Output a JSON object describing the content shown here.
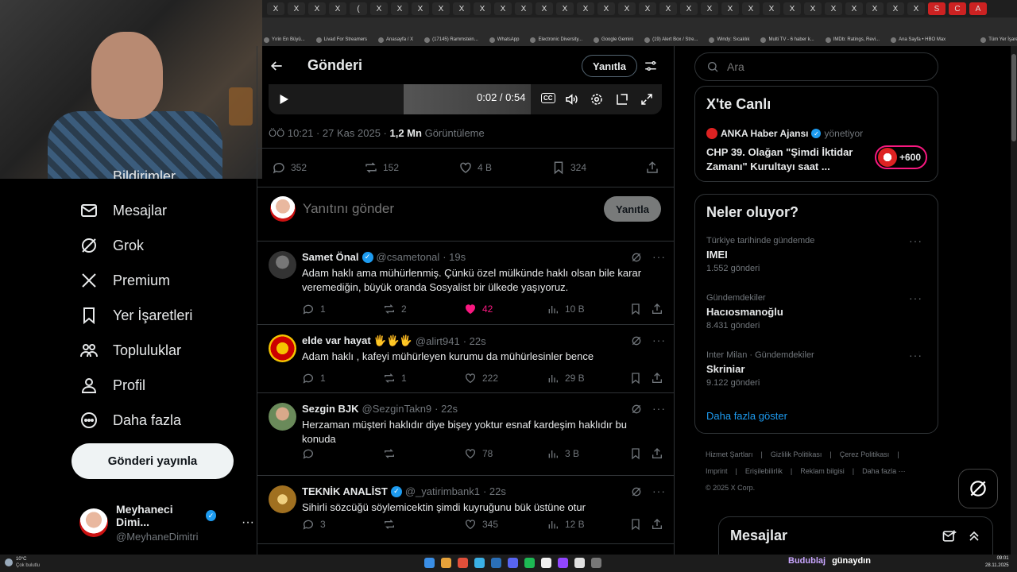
{
  "browser": {
    "tabs": [
      "X",
      "X",
      "X",
      "X",
      "(",
      "X",
      "X",
      "X",
      "X",
      "X",
      "X",
      "X",
      "X",
      "X",
      "X",
      "X",
      "X",
      "X",
      "X",
      "X",
      "X",
      "X",
      "X",
      "X",
      "X",
      "X",
      "X",
      "X",
      "X",
      "X",
      "X",
      "X",
      "S",
      "C",
      "A"
    ],
    "bookmarks": [
      "Yırin En Büyü...",
      "Livad For Streamers",
      "Anasayfa / X",
      "(17145) Rammstein...",
      "WhatsApp",
      "Electronic Diversity...",
      "Google Gemini",
      "(19) Alert Box / Stre...",
      "Windy: Sıcaklık",
      "Multi TV - 6 haber k...",
      "IMDb: Ratings, Revi...",
      "Ana Sayfa • HBO Max",
      "Tüm Yer İşaretleri"
    ]
  },
  "nav": {
    "partial_label": "Bildirimler",
    "items": [
      {
        "label": "Mesajlar",
        "icon": "mail-icon"
      },
      {
        "label": "Grok",
        "icon": "grok-icon"
      },
      {
        "label": "Premium",
        "icon": "x-logo-icon"
      },
      {
        "label": "Yer İşaretleri",
        "icon": "bookmark-icon"
      },
      {
        "label": "Topluluklar",
        "icon": "communities-icon"
      },
      {
        "label": "Profil",
        "icon": "profile-icon"
      },
      {
        "label": "Daha fazla",
        "icon": "more-circle-icon"
      }
    ],
    "post_button": "Gönderi yayınla",
    "profile": {
      "name": "Meyhaneci Dimi...",
      "handle": "@MeyhaneDimitri",
      "more": "···"
    }
  },
  "post": {
    "header_title": "Gönderi",
    "reply_button": "Yanıtla",
    "video": {
      "time": "0:02 / 0:54",
      "cc": "CC"
    },
    "timestamp": "ÖÖ 10:21 · 27 Kas 2025 · ",
    "views_count": "1,2 Mn",
    "views_label": "Görüntüleme",
    "stats": {
      "replies": "352",
      "reposts": "152",
      "likes": "4 B",
      "bookmarks": "324"
    },
    "compose": {
      "placeholder": "Yanıtını gönder",
      "button": "Yanıtla"
    }
  },
  "replies": [
    {
      "name": "Samet Önal",
      "verified": true,
      "handle": "@csametonal",
      "time": "· 19s",
      "text": "Adam haklı ama mühürlenmiş. Çünkü özel mülkünde haklı olsan bile karar veremediğin, büyük oranda Sosyalist bir ülkede yaşıyoruz.",
      "replies": "1",
      "reposts": "2",
      "likes": "42",
      "views": "10 B",
      "liked": true
    },
    {
      "name": "elde var hayat 🖐🖐🖐",
      "verified": false,
      "handle": "@alirt941",
      "time": "· 22s",
      "text": "Adam haklı , kafeyi mühürleyen kurumu da mühürlesinler bence",
      "replies": "1",
      "reposts": "1",
      "likes": "222",
      "views": "29 B",
      "liked": false
    },
    {
      "name": "Sezgin BJK",
      "verified": false,
      "handle": "@SezginTakn9",
      "time": "· 22s",
      "text": "Herzaman müşteri haklıdır diye bişey yoktur esnaf kardeşim haklıdır bu konuda",
      "replies": "",
      "reposts": "",
      "likes": "78",
      "views": "3 B",
      "liked": false
    },
    {
      "name": "TEKNİK ANALİST",
      "verified": true,
      "handle": "@_yatirimbank1",
      "time": "· 22s",
      "text": "Sihirli sözcüğü söylemicektin şimdi kuyruğunu bük üstüne otur",
      "replies": "3",
      "reposts": "",
      "likes": "345",
      "views": "12 B",
      "liked": false
    }
  ],
  "sidebar": {
    "search_placeholder": "Ara",
    "live": {
      "title": "X'te Canlı",
      "source": "ANKA Haber Ajansı",
      "action": "yönetiyor",
      "text": "CHP 39. Olağan \"Şimdi İktidar Zamanı\" Kurultayı saat ...",
      "badge": "+600"
    },
    "trends_title": "Neler oluyor?",
    "trends": [
      {
        "category": "Türkiye tarihinde gündemde",
        "name": "IMEI",
        "count": "1.552 gönderi"
      },
      {
        "category": "Gündemdekiler",
        "name": "Hacıosmanoğlu",
        "count": "8.431 gönderi"
      },
      {
        "category": "Inter Milan · Gündemdekiler",
        "name": "Skriniar",
        "count": "9.122 gönderi"
      }
    ],
    "show_more": "Daha fazla göster",
    "footer": [
      "Hizmet Şartları",
      "|",
      "Gizlilik Politikası",
      "|",
      "Çerez Politikası",
      "|",
      "Imprint",
      "|",
      "Erişilebilirlik",
      "|",
      "Reklam bilgisi",
      "|",
      "Daha fazla ···",
      "© 2025 X Corp."
    ]
  },
  "messages_drawer": {
    "title": "Mesajlar"
  },
  "taskbar": {
    "weather_temp": "10°C",
    "weather_desc": "Çok bulutlu",
    "now_playing_artist": "Budublaj",
    "now_playing_title": "günaydın",
    "time": "09:01",
    "date": "28.11.2025"
  },
  "colors": {
    "accent": "#1d9bf0",
    "like": "#f91880",
    "bg": "#000000",
    "border": "#2f3336",
    "muted": "#71767b"
  }
}
